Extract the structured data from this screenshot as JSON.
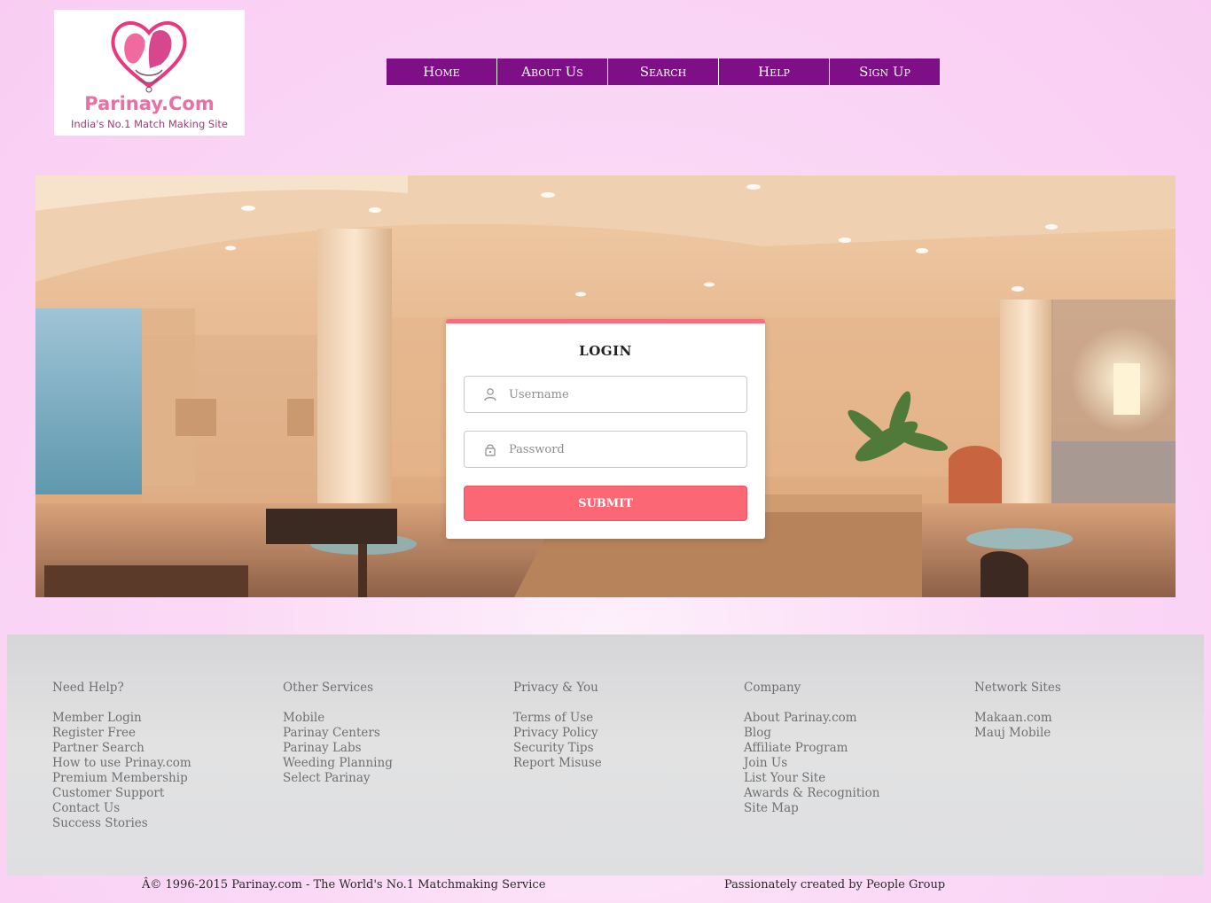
{
  "logo": {
    "brand": "Parinay.Com",
    "tagline": "India's No.1 Match Making Site",
    "icon": "heart-couple-logo"
  },
  "nav": {
    "items": [
      {
        "label": "Home"
      },
      {
        "label": "About Us"
      },
      {
        "label": "Search"
      },
      {
        "label": "Help"
      },
      {
        "label": "Sign Up"
      }
    ]
  },
  "login": {
    "title": "LOGIN",
    "username_placeholder": "Username",
    "password_placeholder": "Password",
    "submit_label": "SUBMIT",
    "username_icon": "user-icon",
    "password_icon": "lock-icon"
  },
  "footer": {
    "columns": [
      {
        "heading": "Need Help?",
        "links": [
          "Member Login",
          "Register Free",
          "Partner Search",
          "How to use Prinay.com",
          "Premium Membership",
          "Customer Support",
          "Contact Us",
          "Success Stories"
        ]
      },
      {
        "heading": "Other Services",
        "links": [
          "Mobile",
          "Parinay Centers",
          "Parinay Labs",
          "Weeding Planning",
          "Select Parinay"
        ]
      },
      {
        "heading": "Privacy & You",
        "links": [
          "Terms of Use",
          "Privacy Policy",
          "Security Tips",
          "Report Misuse"
        ]
      },
      {
        "heading": "Company",
        "links": [
          "About Parinay.com",
          "Blog",
          "Affiliate Program",
          "Join Us",
          "List Your Site",
          "Awards & Recognition",
          "Site Map"
        ]
      },
      {
        "heading": "Network Sites",
        "links": [
          "Makaan.com",
          "Mauj Mobile"
        ]
      }
    ],
    "copyright": "Â© 1996-2015 Parinay.com - The World's No.1 Matchmaking Service",
    "credit": "Passionately created by People Group"
  },
  "colors": {
    "nav_bg": "#7e0f86",
    "accent": "#fb6775",
    "page_bg": "#fbd9f6"
  }
}
